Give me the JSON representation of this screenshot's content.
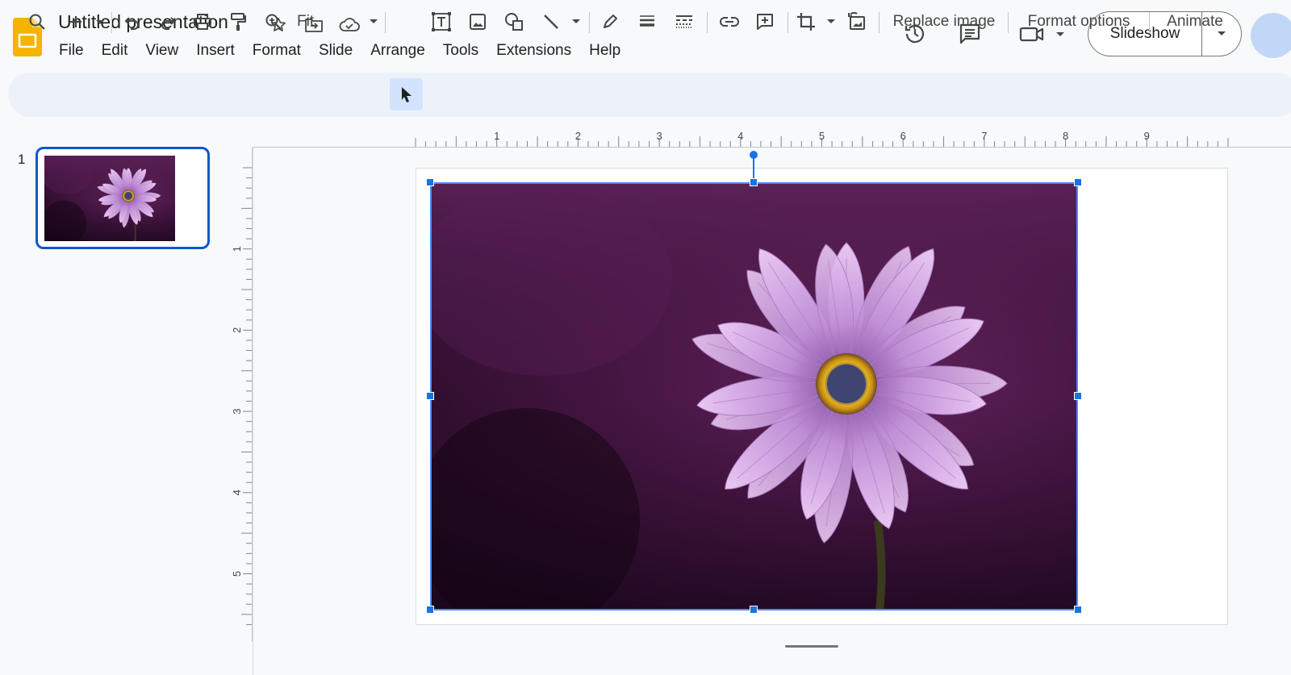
{
  "app": {
    "doc_title": "Untitled presentation",
    "menus": [
      "File",
      "Edit",
      "View",
      "Insert",
      "Format",
      "Slide",
      "Arrange",
      "Tools",
      "Extensions",
      "Help"
    ],
    "title_icons": [
      "star-icon",
      "move-to-folder-icon",
      "cloud-saved-icon"
    ],
    "header_icons": [
      "version-history-icon",
      "comments-icon",
      "meet-camera-icon"
    ]
  },
  "slideshow": {
    "label": "Slideshow"
  },
  "toolbar": {
    "zoom_value": "Fit",
    "replace_image": "Replace image",
    "format_options": "Format options",
    "animate": "Animate"
  },
  "filmstrip": {
    "slide_number": "1"
  },
  "ruler": {
    "horizontal_labels": [
      "1",
      "2",
      "3",
      "4",
      "5",
      "6",
      "7",
      "8",
      "9"
    ],
    "vertical_labels": [
      "1",
      "2",
      "3",
      "4",
      "5"
    ]
  },
  "colors": {
    "accent": "#0b57d0",
    "selection": "#1a73e8",
    "toolbar_bg": "#edf2fa",
    "logo": "#f4b400"
  }
}
